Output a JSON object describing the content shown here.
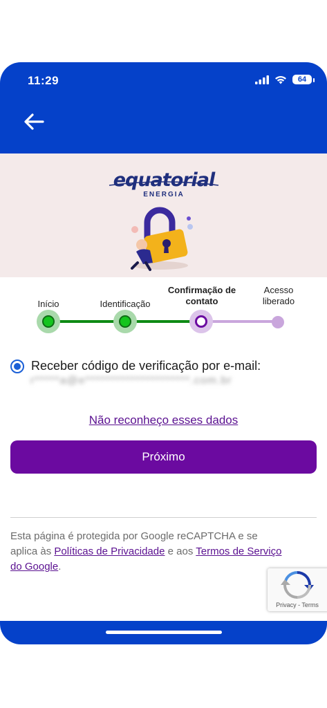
{
  "status_bar": {
    "time": "11:29",
    "battery": "64"
  },
  "header": {
    "back_icon": "arrow-left-icon"
  },
  "brand": {
    "logo_word": "equatorial",
    "logo_sub": "ENERGIA"
  },
  "stepper": {
    "steps": [
      {
        "label": "Início",
        "state": "done"
      },
      {
        "label": "Identificação",
        "state": "done"
      },
      {
        "label": "Confirmação de contato",
        "state": "current"
      },
      {
        "label": "Acesso liberado",
        "state": "pending"
      }
    ],
    "colors": {
      "done": "#0e8a14",
      "current": "#6b0aa0",
      "pending": "#c9a6dc"
    }
  },
  "contact_option": {
    "label": "Receber código de verificação por e-mail:",
    "masked_value": "r*****a@e*********************.com.br",
    "selected": true
  },
  "links": {
    "unknown_data": "Não reconheço esses dados"
  },
  "actions": {
    "next_label": "Próximo"
  },
  "notice": {
    "part1": "Esta página é protegida por Google reCAPTCHA e se aplica às ",
    "privacy_link": "Políticas de Privacidade",
    "part2": " e aos ",
    "terms_link": "Termos de Serviço do Google",
    "part3": "."
  },
  "recaptcha": {
    "label": "Privacy - Terms"
  },
  "colors": {
    "header_blue": "#0541c9",
    "primary_purple": "#6b0aa0",
    "hero_bg": "#f4eaea"
  }
}
